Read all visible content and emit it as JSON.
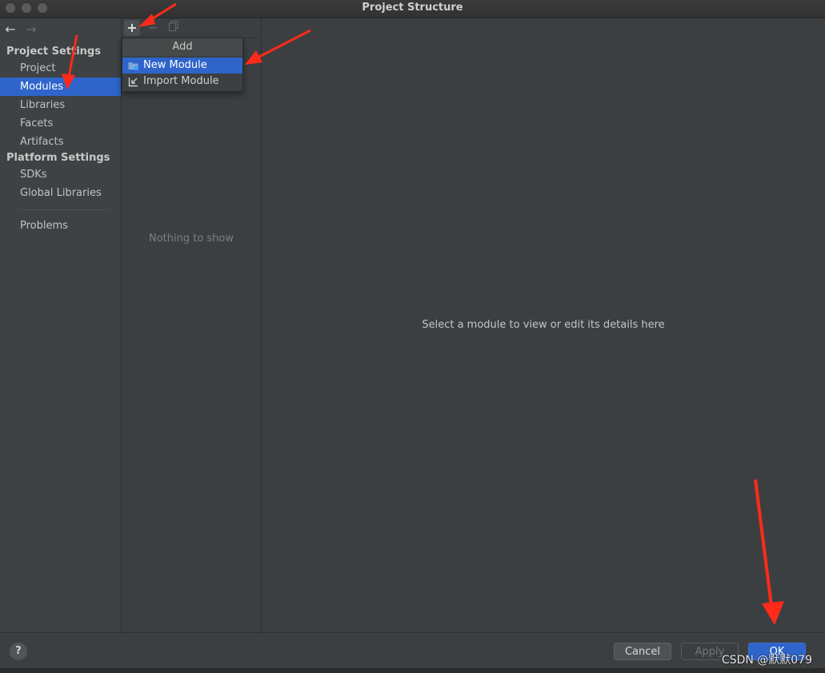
{
  "window": {
    "title": "Project Structure"
  },
  "nav": {
    "back_icon": "arrow-left-icon",
    "forward_icon": "arrow-right-icon"
  },
  "sidebar": {
    "project_settings_header": "Project Settings",
    "project_settings_items": [
      {
        "label": "Project",
        "selected": false
      },
      {
        "label": "Modules",
        "selected": true
      },
      {
        "label": "Libraries",
        "selected": false
      },
      {
        "label": "Facets",
        "selected": false
      },
      {
        "label": "Artifacts",
        "selected": false
      }
    ],
    "platform_settings_header": "Platform Settings",
    "platform_settings_items": [
      {
        "label": "SDKs"
      },
      {
        "label": "Global Libraries"
      }
    ],
    "problems_label": "Problems"
  },
  "toolbar": {
    "add_symbol": "+",
    "remove_symbol": "−"
  },
  "middle": {
    "empty_text": "Nothing to show"
  },
  "popup": {
    "title": "Add",
    "items": [
      {
        "label": "New Module",
        "icon": "module-folder-icon",
        "selected": true
      },
      {
        "label": "Import Module",
        "icon": "import-icon",
        "selected": false
      }
    ]
  },
  "detail": {
    "placeholder": "Select a module to view or edit its details here"
  },
  "footer": {
    "help_symbol": "?",
    "cancel_label": "Cancel",
    "apply_label": "Apply",
    "ok_label": "OK"
  },
  "watermark": "CSDN @默默079",
  "colors": {
    "accent": "#2f65ca",
    "panel": "#3c3f41",
    "annotation": "#ff2a1a"
  }
}
